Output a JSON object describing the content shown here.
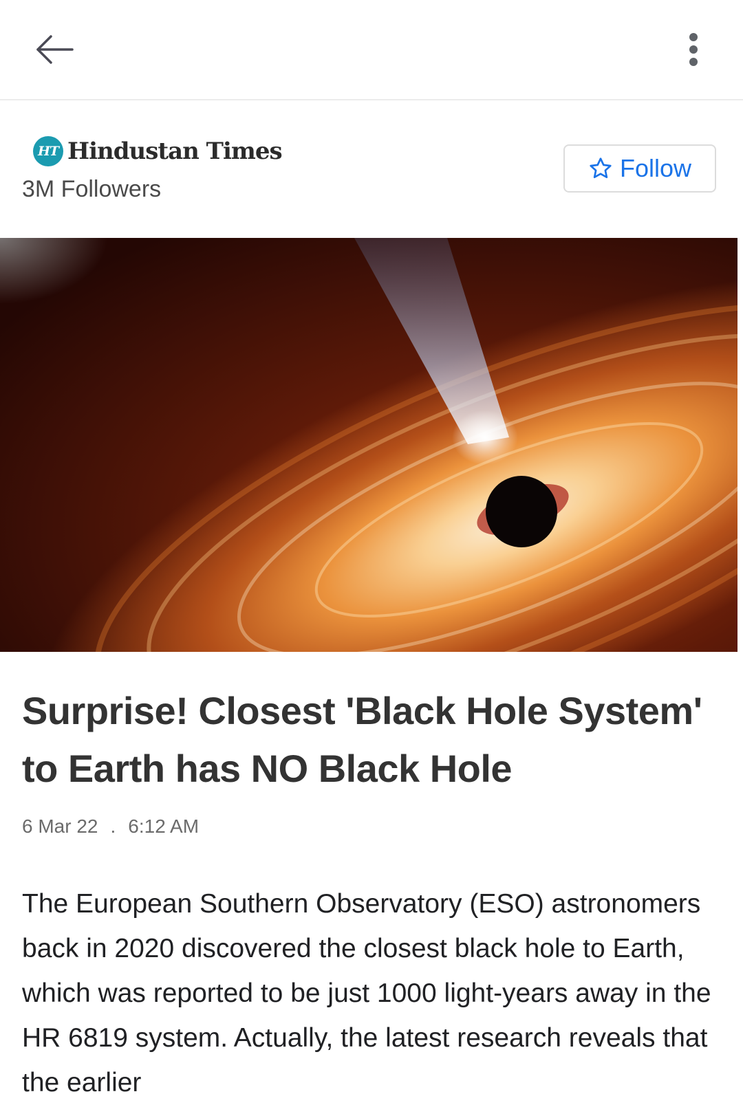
{
  "header": {
    "back_icon": "arrow-left-icon",
    "more_icon": "vertical-dots-icon"
  },
  "publisher": {
    "logo_badge": "HT",
    "name": "Hindustan Times",
    "followers": "3M Followers",
    "follow_label": "Follow",
    "follow_icon": "star-outline-icon",
    "accent_color": "#1a73e8",
    "logo_color": "#1b9bb0"
  },
  "article": {
    "hero_image": "black-hole-accretion-disk",
    "headline": "Surprise! Closest 'Black Hole System' to Earth has NO Black Hole",
    "date": "6 Mar 22",
    "separator": ".",
    "time": "6:12 AM",
    "body": "The European Southern Observatory (ESO) astronomers back in 2020 discovered the closest black hole to Earth, which was reported to be just 1000 light-years away in the HR 6819 system. Actually, the latest research reveals that the earlier"
  }
}
